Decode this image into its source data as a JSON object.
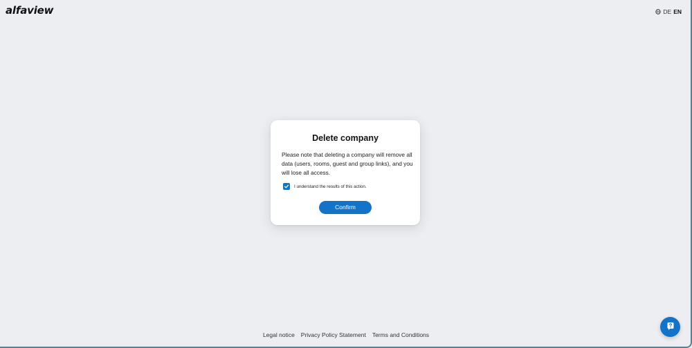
{
  "header": {
    "logo_text": "alfaview",
    "language": {
      "icon": "globe-icon",
      "options": [
        "DE",
        "EN"
      ],
      "selected": "EN"
    }
  },
  "dialog": {
    "title": "Delete company",
    "message": "Please note that deleting a company will remove all data (users, rooms, guest and group links), and you will lose all access.",
    "checkbox": {
      "label": "I understand the results of this action.",
      "checked": true,
      "icon": "checkmark-icon"
    },
    "confirm_label": "Confirm"
  },
  "footer": {
    "links": [
      "Legal notice",
      "Privacy Policy Statement",
      "Terms and Conditions"
    ]
  },
  "help_button": {
    "icon": "help-question-icon"
  },
  "colors": {
    "background": "#eceef2",
    "accent": "#1273c9",
    "dialog_bg": "#ffffff",
    "text": "#1c1c1e"
  }
}
